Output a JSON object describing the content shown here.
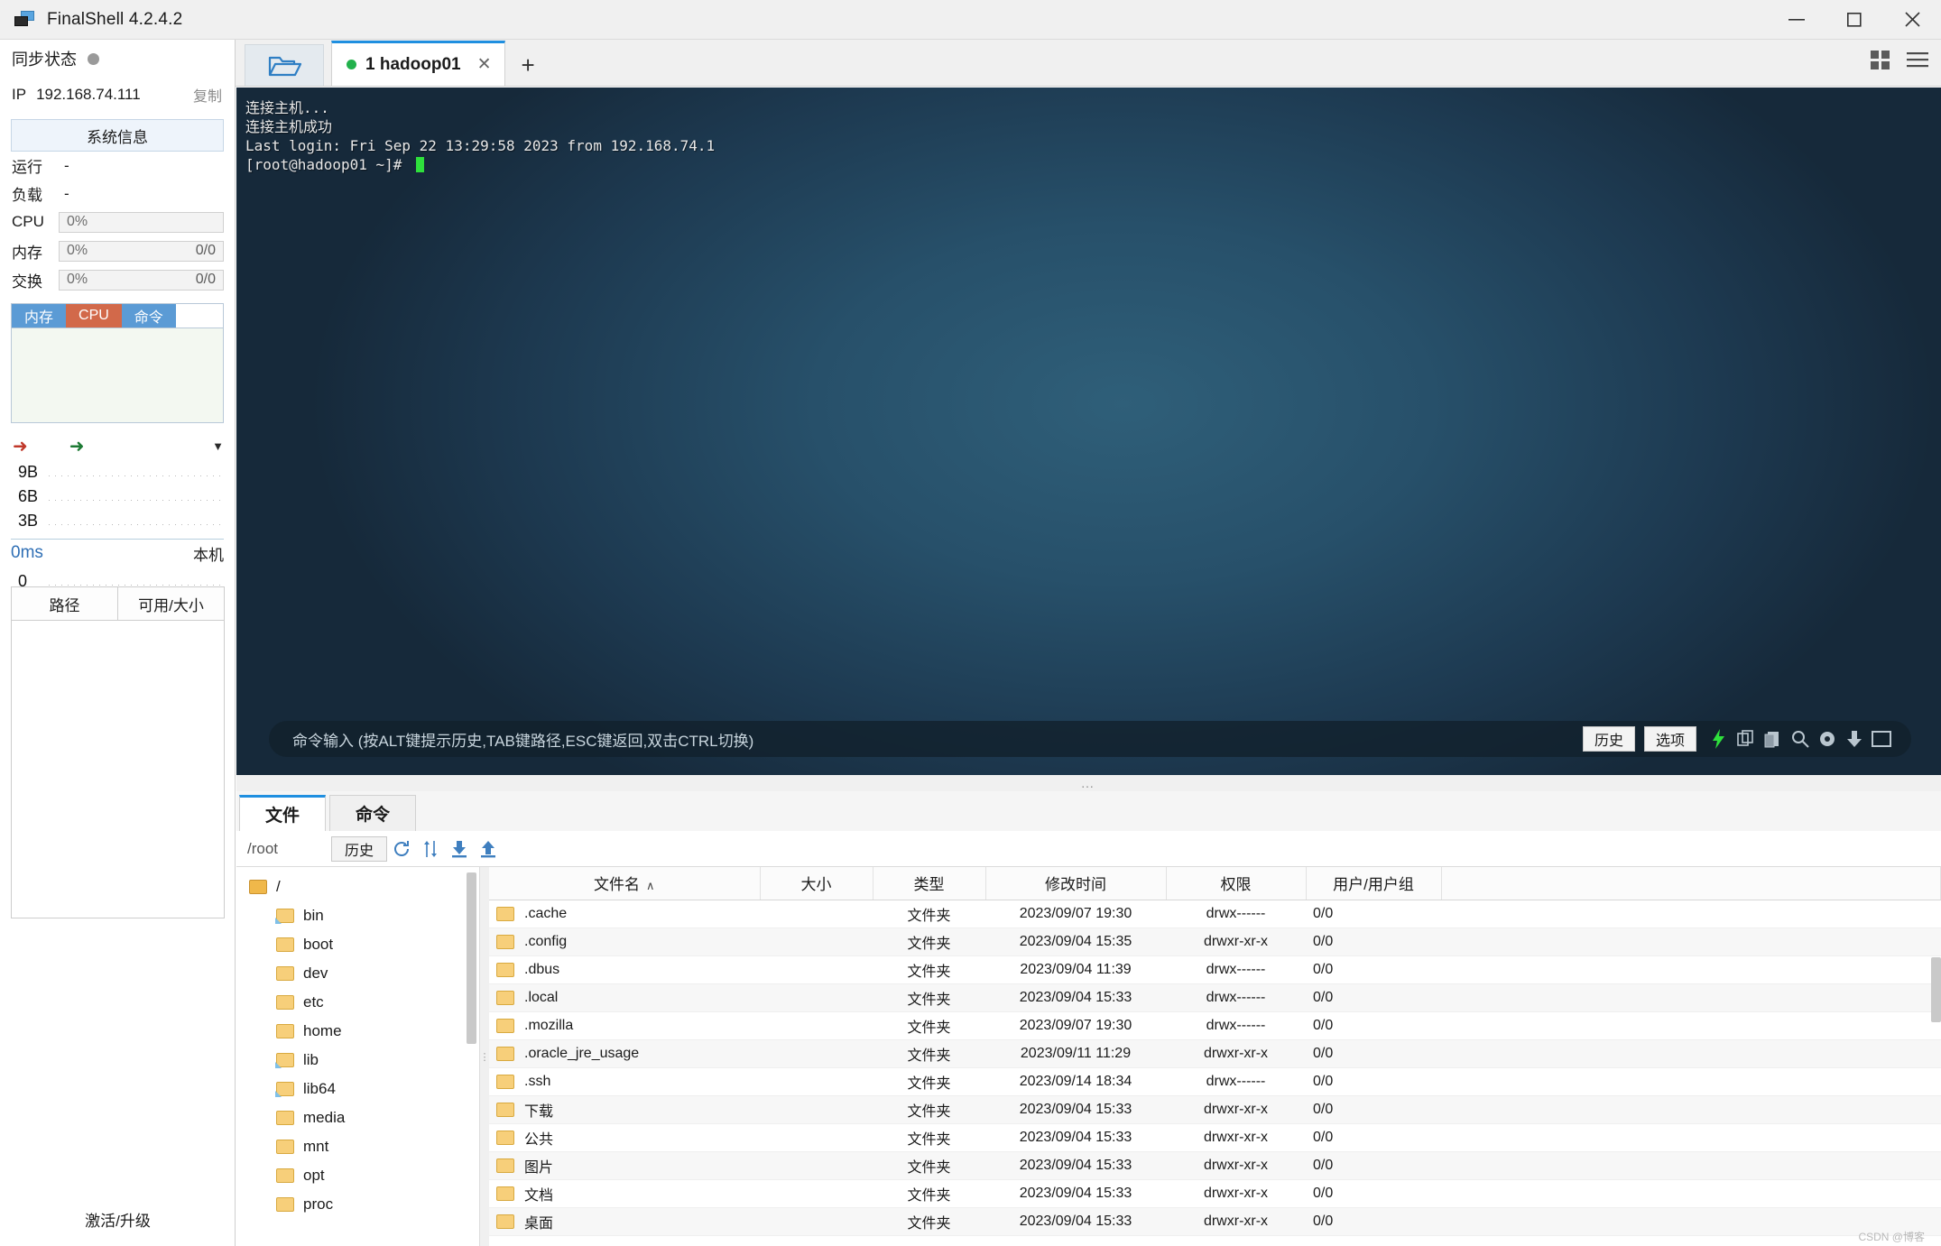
{
  "window": {
    "title": "FinalShell 4.2.4.2",
    "app_icon": "monitor-icon",
    "minimize": "–",
    "maximize": "□",
    "close": "✕"
  },
  "sidebar": {
    "sync_label": "同步状态",
    "sync_dot_color": "#9a9a9a",
    "ip_key": "IP",
    "ip_value": "192.168.74.111",
    "copy_label": "复制",
    "sysinfo_button": "系统信息",
    "uptime_key": "运行",
    "uptime_value": "-",
    "load_key": "负载",
    "load_value": "-",
    "meters": [
      {
        "key": "CPU",
        "value": "0%",
        "right": ""
      },
      {
        "key": "内存",
        "value": "0%",
        "right": "0/0"
      },
      {
        "key": "交换",
        "value": "0%",
        "right": "0/0"
      }
    ],
    "mini_tabs": [
      {
        "label": "内存",
        "color": "#5b9bd5"
      },
      {
        "label": "CPU",
        "color": "#d2694a"
      },
      {
        "label": "命令",
        "color": "#5b9bd5"
      }
    ],
    "network": {
      "up_icon": "arrow-up-icon",
      "down_icon": "arrow-down-icon",
      "expand_icon": "chevron-down-icon",
      "scale_labels": [
        "9B",
        "6B",
        "3B"
      ]
    },
    "ping": {
      "value": "0ms",
      "local_label": "本机",
      "scale_labels": [
        "0",
        "0",
        "0"
      ]
    },
    "disk_tabs": [
      "路径",
      "可用/大小"
    ],
    "activate_label": "激活/升级"
  },
  "tabstrip": {
    "folder_icon": "open-folder-icon",
    "tabs": [
      {
        "label": "1 hadoop01",
        "status_color": "#22b14c",
        "close": "✕"
      }
    ],
    "add_tab": "+",
    "grid_icon": "grid-view-icon",
    "menu_icon": "hamburger-menu-icon"
  },
  "terminal": {
    "lines": [
      "连接主机...",
      "连接主机成功",
      "Last login: Fri Sep 22 13:29:58 2023 from 192.168.74.1",
      "[root@hadoop01 ~]# "
    ],
    "cursor_color": "#2ee03c",
    "command_placeholder": "命令输入 (按ALT键提示历史,TAB键路径,ESC键返回,双击CTRL切换)",
    "buttons": [
      {
        "label": "历史",
        "name": "history-button"
      },
      {
        "label": "选项",
        "name": "options-button"
      }
    ],
    "icons": [
      {
        "name": "lightning-icon",
        "glyph": "⚡",
        "color": "#2ee03c"
      },
      {
        "name": "copy-icon",
        "glyph": "❐",
        "color": "#b9c6cf"
      },
      {
        "name": "paste-icon",
        "glyph": "⎘",
        "color": "#b9c6cf"
      },
      {
        "name": "search-icon",
        "glyph": "⌕",
        "color": "#b9c6cf"
      },
      {
        "name": "gear-icon",
        "glyph": "⚙",
        "color": "#b9c6cf"
      },
      {
        "name": "download-icon",
        "glyph": "↓",
        "color": "#b9c6cf"
      },
      {
        "name": "window-icon",
        "glyph": "▭",
        "color": "#b9c6cf"
      }
    ]
  },
  "filepanel": {
    "tabs": [
      {
        "label": "文件",
        "active": true
      },
      {
        "label": "命令",
        "active": false
      }
    ],
    "path": "/root",
    "history_button": "历史",
    "toolbar_icons": [
      {
        "name": "refresh-icon",
        "glyph": "↻"
      },
      {
        "name": "sort-icon",
        "glyph": "↕"
      },
      {
        "name": "download-icon",
        "glyph": "⤓"
      },
      {
        "name": "upload-icon",
        "glyph": "⤒"
      }
    ],
    "tree": [
      {
        "label": "/",
        "depth": 0,
        "icon": "folder-open-icon"
      },
      {
        "label": "bin",
        "depth": 1,
        "icon": "folder-link-icon"
      },
      {
        "label": "boot",
        "depth": 1,
        "icon": "folder-icon"
      },
      {
        "label": "dev",
        "depth": 1,
        "icon": "folder-icon"
      },
      {
        "label": "etc",
        "depth": 1,
        "icon": "folder-icon"
      },
      {
        "label": "home",
        "depth": 1,
        "icon": "folder-icon"
      },
      {
        "label": "lib",
        "depth": 1,
        "icon": "folder-link-icon"
      },
      {
        "label": "lib64",
        "depth": 1,
        "icon": "folder-link-icon"
      },
      {
        "label": "media",
        "depth": 1,
        "icon": "folder-icon"
      },
      {
        "label": "mnt",
        "depth": 1,
        "icon": "folder-icon"
      },
      {
        "label": "opt",
        "depth": 1,
        "icon": "folder-icon"
      },
      {
        "label": "proc",
        "depth": 1,
        "icon": "folder-icon"
      }
    ],
    "columns": [
      "文件名",
      "大小",
      "类型",
      "修改时间",
      "权限",
      "用户/用户组"
    ],
    "sort_indicator": "∧",
    "rows": [
      {
        "name": ".cache",
        "size": "",
        "type": "文件夹",
        "mtime": "2023/09/07 19:30",
        "perm": "drwx------",
        "owner": "0/0"
      },
      {
        "name": ".config",
        "size": "",
        "type": "文件夹",
        "mtime": "2023/09/04 15:35",
        "perm": "drwxr-xr-x",
        "owner": "0/0"
      },
      {
        "name": ".dbus",
        "size": "",
        "type": "文件夹",
        "mtime": "2023/09/04 11:39",
        "perm": "drwx------",
        "owner": "0/0"
      },
      {
        "name": ".local",
        "size": "",
        "type": "文件夹",
        "mtime": "2023/09/04 15:33",
        "perm": "drwx------",
        "owner": "0/0"
      },
      {
        "name": ".mozilla",
        "size": "",
        "type": "文件夹",
        "mtime": "2023/09/07 19:30",
        "perm": "drwx------",
        "owner": "0/0"
      },
      {
        "name": ".oracle_jre_usage",
        "size": "",
        "type": "文件夹",
        "mtime": "2023/09/11 11:29",
        "perm": "drwxr-xr-x",
        "owner": "0/0"
      },
      {
        "name": ".ssh",
        "size": "",
        "type": "文件夹",
        "mtime": "2023/09/14 18:34",
        "perm": "drwx------",
        "owner": "0/0"
      },
      {
        "name": "下载",
        "size": "",
        "type": "文件夹",
        "mtime": "2023/09/04 15:33",
        "perm": "drwxr-xr-x",
        "owner": "0/0"
      },
      {
        "name": "公共",
        "size": "",
        "type": "文件夹",
        "mtime": "2023/09/04 15:33",
        "perm": "drwxr-xr-x",
        "owner": "0/0"
      },
      {
        "name": "图片",
        "size": "",
        "type": "文件夹",
        "mtime": "2023/09/04 15:33",
        "perm": "drwxr-xr-x",
        "owner": "0/0"
      },
      {
        "name": "文档",
        "size": "",
        "type": "文件夹",
        "mtime": "2023/09/04 15:33",
        "perm": "drwxr-xr-x",
        "owner": "0/0"
      },
      {
        "name": "桌面",
        "size": "",
        "type": "文件夹",
        "mtime": "2023/09/04 15:33",
        "perm": "drwxr-xr-x",
        "owner": "0/0"
      }
    ]
  },
  "watermark": "CSDN @博客"
}
